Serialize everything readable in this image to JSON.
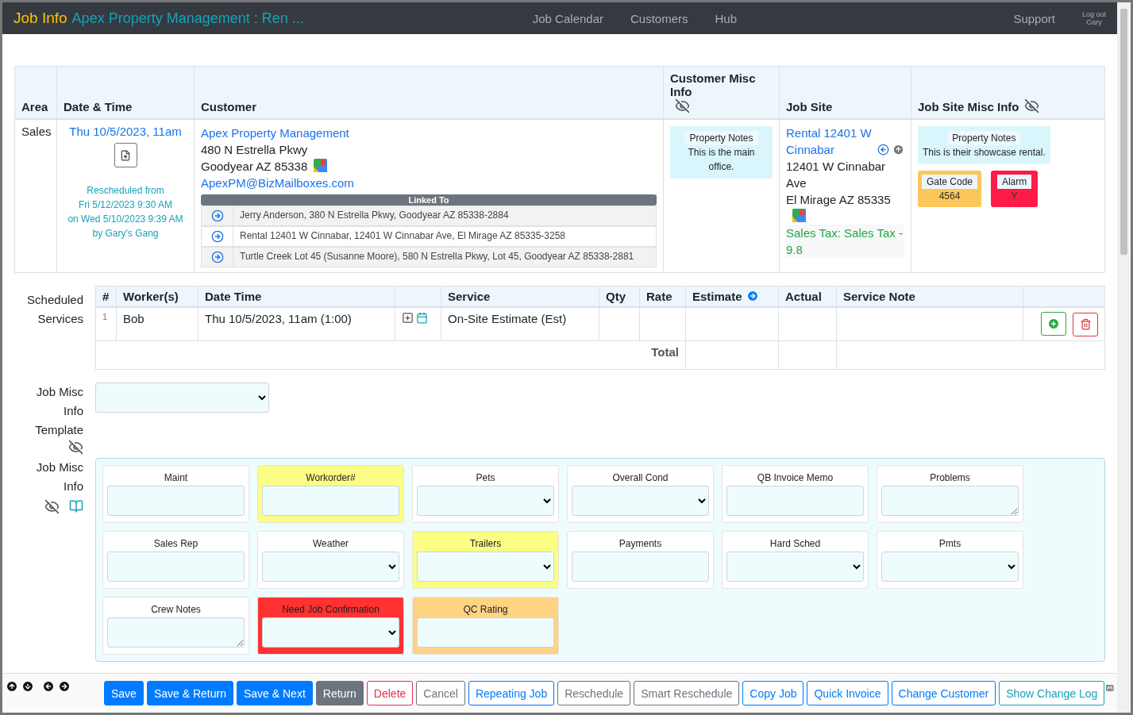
{
  "navbar": {
    "title": "Job Info",
    "subtitle": "Apex Property Management : Ren ...",
    "links": [
      "Job Calendar",
      "Customers",
      "Hub"
    ],
    "support": "Support",
    "logout": "Log out",
    "user": "Gary"
  },
  "job_table": {
    "columns": [
      {
        "label": "Area",
        "eye_off": false
      },
      {
        "label": "Date & Time",
        "eye_off": false
      },
      {
        "label": "Customer",
        "eye_off": false
      },
      {
        "label": "Customer Misc Info",
        "eye_off": true
      },
      {
        "label": "Job Site",
        "eye_off": false
      },
      {
        "label": "Job Site Misc Info",
        "eye_off": true
      }
    ],
    "row": {
      "area": "Sales",
      "date": "Thu 10/5/2023, 11am",
      "reschedule": [
        "Rescheduled from",
        "Fri 5/12/2023 9:30 AM",
        "on Wed 5/10/2023 9:39 AM",
        "by Gary's Gang"
      ],
      "customer": {
        "name": "Apex Property Management",
        "address": [
          "480 N Estrella Pkwy",
          "Goodyear AZ 85338"
        ],
        "email": "ApexPM@BizMailboxes.com",
        "linked_title": "Linked To",
        "linked": [
          "Jerry Anderson, 380 N Estrella Pkwy, Goodyear AZ 85338-2884",
          "Rental 12401 W Cinnabar, 12401 W Cinnabar Ave, El Mirage AZ 85335-3258",
          "Turtle Creek Lot 45 (Susanne Moore), 580 N Estrella Pkwy, Lot 45, Goodyear AZ 85338-2881"
        ]
      },
      "customer_misc": {
        "title": "Property Notes",
        "value": "This is the main office."
      },
      "job_site": {
        "name": "Rental 12401 W Cinnabar",
        "address": [
          "12401 W Cinnabar Ave",
          "El Mirage AZ 85335"
        ],
        "tax": "Sales Tax: Sales Tax - 9.8"
      },
      "job_site_misc": {
        "notes": {
          "title": "Property Notes",
          "value": "This is their showcase rental."
        },
        "badges": [
          {
            "label": "Gate Code",
            "value": "4564",
            "color": "#fcc75a"
          },
          {
            "label": "Alarm",
            "value": "Y",
            "color": "#ff1a48"
          }
        ]
      }
    }
  },
  "services": {
    "label": "Scheduled Services",
    "columns": [
      "#",
      "Worker(s)",
      "Date Time",
      "Service",
      "Qty",
      "Rate",
      "Estimate",
      "Actual",
      "Service Note"
    ],
    "rows": [
      {
        "num": "1",
        "worker": "Bob",
        "datetime": "Thu 10/5/2023, 11am (1:00)",
        "service": "On-Site Estimate (Est)"
      }
    ],
    "total_label": "Total"
  },
  "template": {
    "label": "Job Misc Info Template"
  },
  "misc_info": {
    "label": "Job Misc Info",
    "fields": [
      {
        "label": "Maint",
        "kind": "input",
        "color": "#ffffff"
      },
      {
        "label": "Workorder#",
        "kind": "input",
        "color": "#fbfd84"
      },
      {
        "label": "Pets",
        "kind": "select",
        "color": "#ffffff"
      },
      {
        "label": "Overall Cond",
        "kind": "select",
        "color": "#ffffff"
      },
      {
        "label": "QB Invoice Memo",
        "kind": "input",
        "color": "#ffffff"
      },
      {
        "label": "Problems",
        "kind": "textarea",
        "color": "#ffffff"
      },
      {
        "label": "Sales Rep",
        "kind": "input",
        "color": "#ffffff"
      },
      {
        "label": "Weather",
        "kind": "select",
        "color": "#ffffff"
      },
      {
        "label": "Trailers",
        "kind": "select",
        "color": "#fbfd84"
      },
      {
        "label": "Payments",
        "kind": "input",
        "color": "#ffffff"
      },
      {
        "label": "Hard Sched",
        "kind": "select",
        "color": "#ffffff"
      },
      {
        "label": "Pmts",
        "kind": "select",
        "color": "#ffffff"
      },
      {
        "label": "Crew Notes",
        "kind": "textarea",
        "color": "#ffffff"
      },
      {
        "label": "Need Job Confirmation",
        "kind": "select",
        "color": "#ff3131"
      },
      {
        "label": "QC Rating",
        "kind": "input",
        "color": "#ffd384"
      }
    ]
  },
  "footer": {
    "buttons": [
      {
        "label": "Save",
        "kind": "primary"
      },
      {
        "label": "Save & Return",
        "kind": "primary"
      },
      {
        "label": "Save & Next",
        "kind": "primary"
      },
      {
        "label": "Return",
        "kind": "secondary"
      },
      {
        "label": "Delete",
        "kind": "outline-danger"
      },
      {
        "label": "Cancel",
        "kind": "outline-secondary"
      },
      {
        "label": "Repeating Job",
        "kind": "outline-primary"
      },
      {
        "label": "Reschedule",
        "kind": "outline-secondary"
      },
      {
        "label": "Smart Reschedule",
        "kind": "outline-secondary"
      },
      {
        "label": "Copy Job",
        "kind": "outline-primary"
      },
      {
        "label": "Quick Invoice",
        "kind": "outline-primary"
      },
      {
        "label": "Change Customer",
        "kind": "outline-primary"
      },
      {
        "label": "Show Change Log",
        "kind": "outline-info"
      }
    ]
  }
}
